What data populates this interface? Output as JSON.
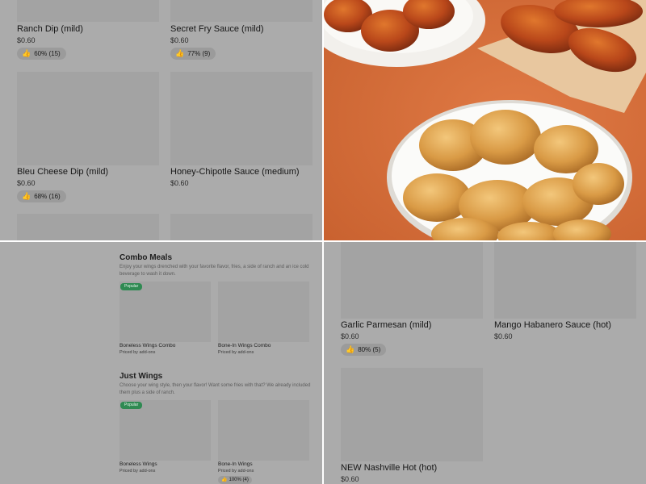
{
  "top_left": {
    "items": [
      {
        "name": "Ranch Dip (mild)",
        "price": "$0.60",
        "rating": "60% (15)"
      },
      {
        "name": "Secret Fry Sauce (mild)",
        "price": "$0.60",
        "rating": "77% (9)"
      },
      {
        "name": "Bleu Cheese Dip (mild)",
        "price": "$0.60",
        "rating": "68% (16)"
      },
      {
        "name": "Honey-Chipotle Sauce (medium)",
        "price": "$0.60",
        "rating": ""
      }
    ]
  },
  "bottom_left": {
    "combo": {
      "title": "Combo Meals",
      "description": "Enjoy your wings drenched with your favorite flavor, fries, a side of ranch and an ice cold beverage to wash it down.",
      "items": [
        {
          "badge": "Popular",
          "name": "Boneless Wings Combo",
          "sub": "Priced by add-ons"
        },
        {
          "badge": "",
          "name": "Bone-In Wings Combo",
          "sub": "Priced by add-ons"
        }
      ]
    },
    "just_wings": {
      "title": "Just Wings",
      "description": "Choose your wing style, then your flavor! Want some fries with that? We already included them plus a side of ranch.",
      "items": [
        {
          "badge": "Popular",
          "name": "Boneless Wings",
          "sub": "Priced by add-ons",
          "rating": ""
        },
        {
          "badge": "",
          "name": "Bone-In Wings",
          "sub": "Priced by add-ons",
          "rating": "100% (4)"
        }
      ]
    }
  },
  "bottom_right": {
    "items": [
      {
        "name": "Garlic Parmesan (mild)",
        "price": "$0.60",
        "rating": "80% (5)"
      },
      {
        "name": "Mango Habanero Sauce (hot)",
        "price": "$0.60",
        "rating": ""
      },
      {
        "name": "NEW Nashville Hot (hot)",
        "price": "$0.60",
        "rating": ""
      }
    ]
  },
  "icons": {
    "rating": "thumbs-up-icon"
  },
  "colors": {
    "popular_badge": "#2f8a52",
    "photo_background": "#d9703e",
    "gray_overlay": "#ababab"
  }
}
